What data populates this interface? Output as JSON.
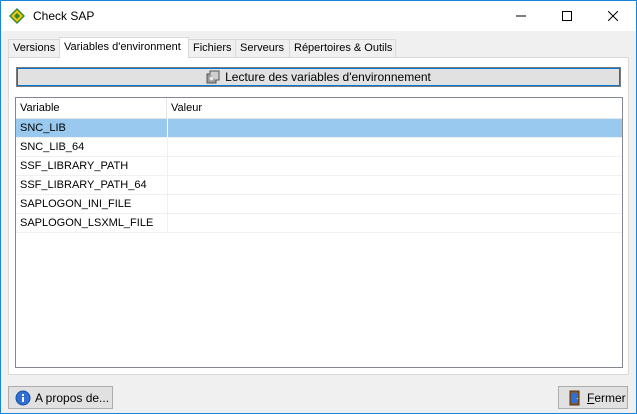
{
  "window": {
    "title": "Check SAP",
    "minimize_glyph": "—",
    "maximize_glyph": "☐",
    "close_glyph": "✕"
  },
  "tabs": [
    {
      "label": "Versions",
      "active": false
    },
    {
      "label": "Variables d'environment",
      "active": true
    },
    {
      "label": "Fichiers",
      "active": false
    },
    {
      "label": "Serveurs",
      "active": false
    },
    {
      "label": "Répertoires & Outils",
      "active": false
    }
  ],
  "panel": {
    "read_button_label": "Lecture des variables d'environnement",
    "columns": {
      "variable": "Variable",
      "valeur": "Valeur"
    },
    "rows": [
      {
        "variable": "SNC_LIB",
        "valeur": "",
        "selected": true
      },
      {
        "variable": "SNC_LIB_64",
        "valeur": "",
        "selected": false
      },
      {
        "variable": "SSF_LIBRARY_PATH",
        "valeur": "",
        "selected": false
      },
      {
        "variable": "SSF_LIBRARY_PATH_64",
        "valeur": "",
        "selected": false
      },
      {
        "variable": "SAPLOGON_INI_FILE",
        "valeur": "",
        "selected": false
      },
      {
        "variable": "SAPLOGON_LSXML_FILE",
        "valeur": "",
        "selected": false
      }
    ]
  },
  "footer": {
    "about_label": "A propos de...",
    "close_label_first": "F",
    "close_label_rest": "ermer"
  },
  "icons": {
    "app": "sap-diamond-icon",
    "read": "read-env-icon",
    "about": "info-icon",
    "close": "exit-door-icon"
  },
  "colors": {
    "selected_row": "#99c9ef",
    "window_border": "#1883d7",
    "focus_outline": "#0078d7"
  }
}
